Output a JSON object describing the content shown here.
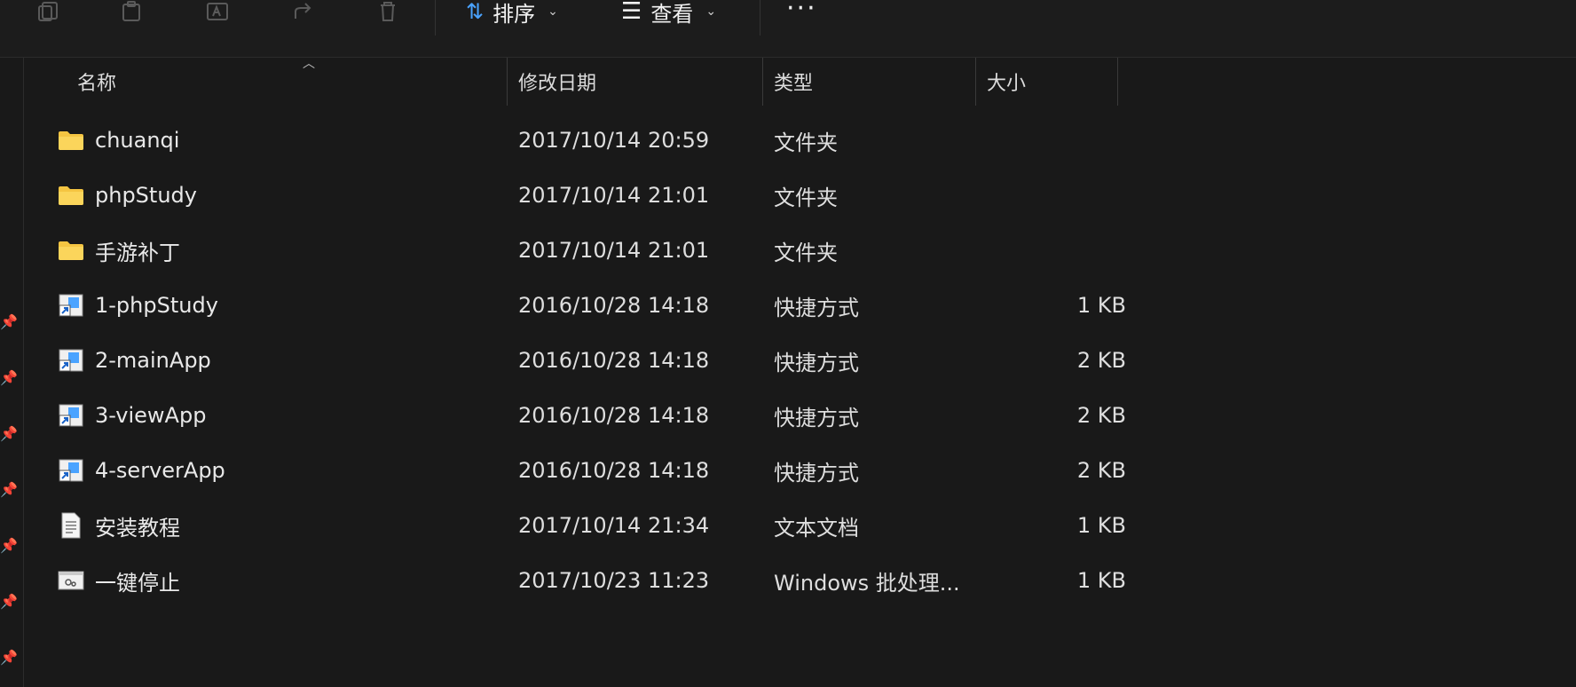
{
  "toolbar": {
    "sort_label": "排序",
    "view_label": "查看",
    "more_label": "···"
  },
  "columns": {
    "name": "名称",
    "date": "修改日期",
    "type": "类型",
    "size": "大小"
  },
  "files": [
    {
      "name": "chuanqi",
      "date": "2017/10/14 20:59",
      "type": "文件夹",
      "size": "",
      "icon": "folder-icon"
    },
    {
      "name": "phpStudy",
      "date": "2017/10/14 21:01",
      "type": "文件夹",
      "size": "",
      "icon": "folder-icon"
    },
    {
      "name": "手游补丁",
      "date": "2017/10/14 21:01",
      "type": "文件夹",
      "size": "",
      "icon": "folder-icon"
    },
    {
      "name": "1-phpStudy",
      "date": "2016/10/28 14:18",
      "type": "快捷方式",
      "size": "1 KB",
      "icon": "shortcut-icon"
    },
    {
      "name": "2-mainApp",
      "date": "2016/10/28 14:18",
      "type": "快捷方式",
      "size": "2 KB",
      "icon": "shortcut-icon"
    },
    {
      "name": "3-viewApp",
      "date": "2016/10/28 14:18",
      "type": "快捷方式",
      "size": "2 KB",
      "icon": "shortcut-icon"
    },
    {
      "name": "4-serverApp",
      "date": "2016/10/28 14:18",
      "type": "快捷方式",
      "size": "2 KB",
      "icon": "shortcut-icon"
    },
    {
      "name": "安装教程",
      "date": "2017/10/14 21:34",
      "type": "文本文档",
      "size": "1 KB",
      "icon": "text-file-icon"
    },
    {
      "name": "一键停止",
      "date": "2017/10/23 11:23",
      "type": "Windows 批处理...",
      "size": "1 KB",
      "icon": "batch-file-icon"
    }
  ],
  "colors": {
    "background": "#191919",
    "folder": "#f5c542",
    "text": "#e8e8e8"
  }
}
